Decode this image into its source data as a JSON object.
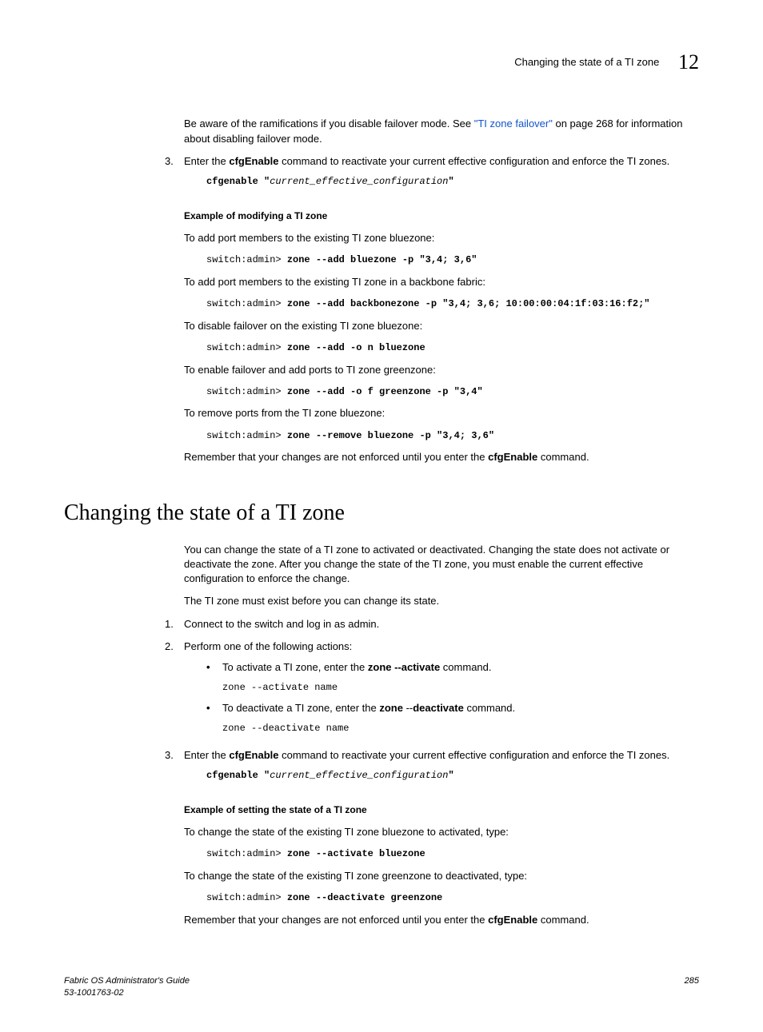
{
  "header": {
    "title": "Changing the state of a TI zone",
    "chapter": "12"
  },
  "p1_before": "Be aware of the ramifications if you disable failover mode. See ",
  "p1_link": "\"TI zone failover\"",
  "p1_after": " on page 268 for information about disabling failover mode.",
  "step3_num": "3.",
  "step3_a": "Enter the ",
  "step3_cmd": "cfgEnable",
  "step3_b": " command to reactivate your current effective configuration and enforce the TI zones.",
  "cfg_cmd_a": "cfgenable \"",
  "cfg_cmd_b": "current_effective_configuration",
  "cfg_cmd_c": "\"",
  "ex_mod_title": "Example of modifying a TI zone",
  "mod1_t": "To add port members to the existing TI zone bluezone:",
  "mod1_p": "switch:admin> ",
  "mod1_c": "zone --add bluezone -p \"3,4; 3,6\"",
  "mod2_t": "To add port members to the existing TI zone in a backbone fabric:",
  "mod2_p": "switch:admin> ",
  "mod2_c": "zone --add backbonezone -p \"3,4; 3,6; 10:00:00:04:1f:03:16:f2;\"",
  "mod3_t": "To disable failover on the existing TI zone bluezone:",
  "mod3_p": "switch:admin> ",
  "mod3_c": "zone --add -o n bluezone",
  "mod4_t": "To enable failover and add ports to TI zone greenzone:",
  "mod4_p": "switch:admin> ",
  "mod4_c": "zone --add -o f greenzone -p \"3,4\"",
  "mod5_t": "To remove ports from the TI zone bluezone:",
  "mod5_p": "switch:admin> ",
  "mod5_c": "zone --remove bluezone -p \"3,4; 3,6\"",
  "remember_a": "Remember that your changes are not enforced until you enter the ",
  "remember_cmd": "cfgEnable",
  "remember_b": " command.",
  "section_title": "Changing the state of a TI zone",
  "s2_p1": "You can change the state of a TI zone to activated or deactivated. Changing the state does not activate or deactivate the zone. After you change the state of the TI zone, you must enable the current effective configuration to enforce the change.",
  "s2_p2": "The TI zone must exist before you can change its state.",
  "s2_step1_num": "1.",
  "s2_step1": "Connect to the switch and log in as admin.",
  "s2_step2_num": "2.",
  "s2_step2": "Perform one of the following actions:",
  "s2_b1_a": "To activate a TI zone, enter the ",
  "s2_b1_cmd": "zone --activate",
  "s2_b1_b": " command.",
  "s2_b1_code_a": "zone --activate ",
  "s2_b1_code_b": "name",
  "s2_b2_a": "To deactivate a TI zone, enter the ",
  "s2_b2_cmd_a": "zone ",
  "s2_b2_cmd_b": "--",
  "s2_b2_cmd_c": "deactivate",
  "s2_b2_b": " command.",
  "s2_b2_code_a": "zone --deactivate ",
  "s2_b2_code_b": "name",
  "s2_step3_num": "3.",
  "s2_step3_a": "Enter the ",
  "s2_step3_cmd": "cfgEnable",
  "s2_step3_b": " command to reactivate your current effective configuration and enforce the TI zones.",
  "s2_cfg_a": "cfgenable \"",
  "s2_cfg_b": "current_effective_configuration",
  "s2_cfg_c": "\"",
  "ex_state_title": "Example of setting the state of a TI zone",
  "st1_t": "To change the state of the existing TI zone bluezone to activated, type:",
  "st1_p": "switch:admin> ",
  "st1_c": "zone --activate bluezone",
  "st2_t": "To change the state of the existing TI zone greenzone to deactivated, type:",
  "st2_p": "switch:admin> ",
  "st2_c": "zone --deactivate greenzone",
  "footer_left_a": "Fabric OS Administrator's Guide",
  "footer_left_b": "53-1001763-02",
  "footer_right": "285"
}
